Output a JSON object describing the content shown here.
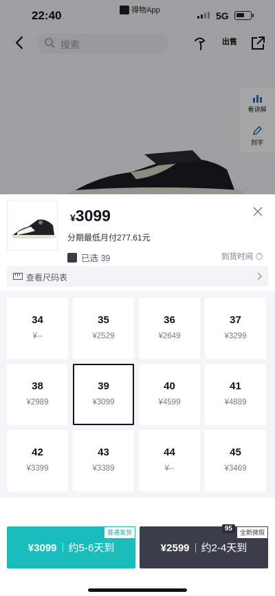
{
  "status": {
    "time": "22:40",
    "carrier": "得物App",
    "network": "5G"
  },
  "nav": {
    "search_placeholder": "搜索",
    "sell_label": "出售"
  },
  "side_tools": [
    {
      "label": "看讲解"
    },
    {
      "label": "刻字"
    }
  ],
  "product": {
    "currency": "¥",
    "price": "3099",
    "installment": "分期最低月付277.61元",
    "selected": "已选 39",
    "arrival": "到货时间"
  },
  "size_chart": {
    "label": "查看尺码表"
  },
  "sizes": [
    {
      "size": "34",
      "price": "¥--"
    },
    {
      "size": "35",
      "price": "¥2529"
    },
    {
      "size": "36",
      "price": "¥2649"
    },
    {
      "size": "37",
      "price": "¥3299"
    },
    {
      "size": "38",
      "price": "¥2989"
    },
    {
      "size": "39",
      "price": "¥3099"
    },
    {
      "size": "40",
      "price": "¥4599"
    },
    {
      "size": "41",
      "price": "¥4889"
    },
    {
      "size": "42",
      "price": "¥3399"
    },
    {
      "size": "43",
      "price": "¥3389"
    },
    {
      "size": "44",
      "price": "¥--"
    },
    {
      "size": "45",
      "price": "¥3469"
    }
  ],
  "selected_size": "39",
  "buy_buttons": [
    {
      "price": "¥3099",
      "eta": "约5-6天到",
      "tag": "普通发货",
      "color": "#1bbcbc"
    },
    {
      "price": "¥2599",
      "eta": "约2-4天到",
      "tag": "全新微瑕",
      "grade": "95",
      "color": "#3c3c4a"
    }
  ]
}
